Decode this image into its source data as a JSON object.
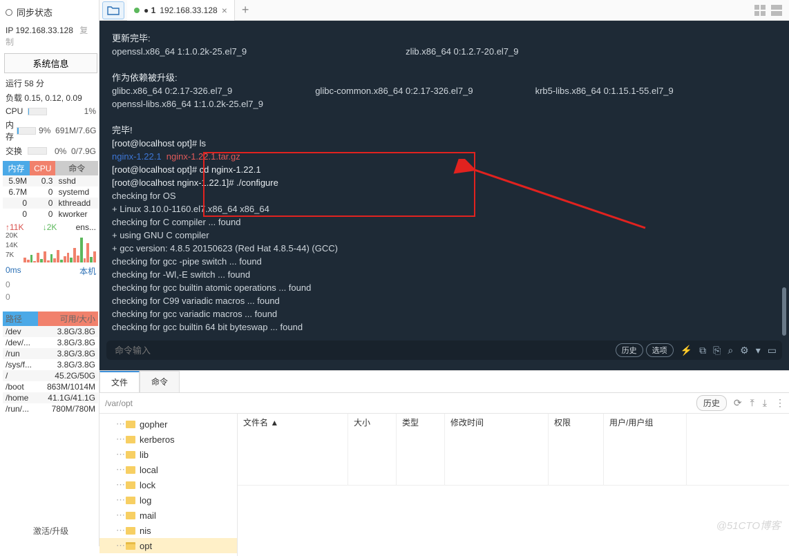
{
  "sidebar": {
    "sync_label": "同步状态",
    "ip": "IP 192.168.33.128",
    "copy": "复制",
    "sysinfo_btn": "系统信息",
    "uptime": "运行 58 分",
    "load": "负载 0.15, 0.12, 0.09",
    "cpu_label": "CPU",
    "cpu_pct": "1%",
    "mem_label": "内存",
    "mem_pct": "9%",
    "mem_val": "691M/7.6G",
    "swap_label": "交换",
    "swap_pct": "0%",
    "swap_val": "0/7.9G",
    "proc_headers": [
      "内存",
      "CPU",
      "命令"
    ],
    "procs": [
      {
        "mem": "5.9M",
        "cpu": "0.3",
        "cmd": "sshd"
      },
      {
        "mem": "6.7M",
        "cpu": "0",
        "cmd": "systemd"
      },
      {
        "mem": "0",
        "cpu": "0",
        "cmd": "kthreadd"
      },
      {
        "mem": "0",
        "cpu": "0",
        "cmd": "kworker"
      }
    ],
    "net_up": "↑11K",
    "net_dn": "↓2K",
    "net_if": "ens...",
    "spark_ticks": [
      "20K",
      "14K",
      "7K"
    ],
    "lat": "0ms",
    "lat_sub1": "0",
    "lat_sub2": "0",
    "host": "本机",
    "fs_headers": [
      "路径",
      "可用/大小"
    ],
    "fs": [
      {
        "p": "/dev",
        "v": "3.8G/3.8G"
      },
      {
        "p": "/dev/...",
        "v": "3.8G/3.8G"
      },
      {
        "p": "/run",
        "v": "3.8G/3.8G"
      },
      {
        "p": "/sys/f...",
        "v": "3.8G/3.8G"
      },
      {
        "p": "/",
        "v": "45.2G/50G"
      },
      {
        "p": "/boot",
        "v": "863M/1014M"
      },
      {
        "p": "/home",
        "v": "41.1G/41.1G"
      },
      {
        "p": "/run/...",
        "v": "780M/780M"
      }
    ],
    "activate": "激活/升级"
  },
  "tabs": {
    "tab1_prefix": "● 1",
    "tab1_addr": "192.168.33.128"
  },
  "terminal": {
    "l1": "更新完毕:",
    "l2": "  openssl.x86_64 1:1.0.2k-25.el7_9",
    "l2b": "zlib.x86_64 0:1.2.7-20.el7_9",
    "l3": "作为依赖被升级:",
    "l4a": "  glibc.x86_64 0:2.17-326.el7_9",
    "l4b": "glibc-common.x86_64 0:2.17-326.el7_9",
    "l4c": "krb5-libs.x86_64 0:1.15.1-55.el7_9",
    "l5": "  openssl-libs.x86_64 1:1.0.2k-25.el7_9",
    "l6": "完毕!",
    "p1": "[root@localhost opt]# ls",
    "ls_a": "nginx-1.22.1",
    "ls_b": "nginx-1.22.1.tar.gz",
    "p2": "[root@localhost opt]# cd nginx-1.22.1",
    "p3": "[root@localhost nginx-1.22.1]# ./configure",
    "c1": "checking for OS",
    "c2": " + Linux 3.10.0-1160.el7.x86_64 x86_64",
    "c3": "checking for C compiler ... found",
    "c4": " + using GNU C compiler",
    "c5": " + gcc version: 4.8.5 20150623 (Red Hat 4.8.5-44) (GCC)",
    "c6": "checking for gcc -pipe switch ... found",
    "c7": "checking for -Wl,-E switch ... found",
    "c8": "checking for gcc builtin atomic operations ... found",
    "c9": "checking for C99 variadic macros ... found",
    "c10": "checking for gcc variadic macros ... found",
    "c11": "checking for gcc builtin 64 bit byteswap ... found",
    "cmd_placeholder": "命令输入",
    "history": "历史",
    "options": "选项"
  },
  "panel": {
    "tab_file": "文件",
    "tab_cmd": "命令",
    "path": "/var/opt",
    "history": "历史",
    "tree": [
      "gopher",
      "kerberos",
      "lib",
      "local",
      "lock",
      "log",
      "mail",
      "nis",
      "opt"
    ],
    "cols": [
      "文件名 ▲",
      "大小",
      "类型",
      "修改时间",
      "权限",
      "用户/用户组"
    ]
  },
  "watermark": "@51CTO博客"
}
